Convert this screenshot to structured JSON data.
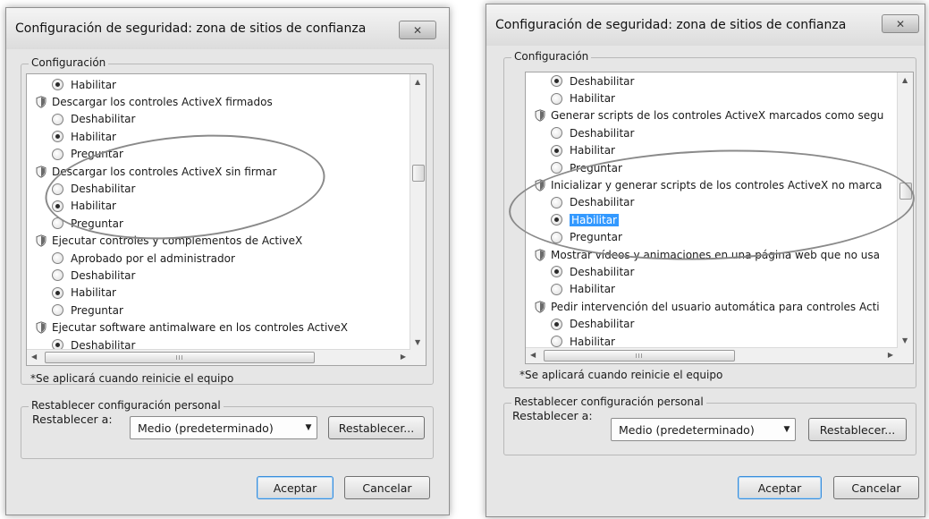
{
  "dialogs": [
    {
      "title": "Configuración de seguridad: zona de sitios de confianza",
      "close_symbol": "✕",
      "group_label": "Configuración",
      "rows": [
        {
          "kind": "option",
          "text": "Habilitar",
          "checked": true
        },
        {
          "kind": "setting",
          "text": "Descargar los controles ActiveX firmados"
        },
        {
          "kind": "option",
          "text": "Deshabilitar",
          "checked": false
        },
        {
          "kind": "option",
          "text": "Habilitar",
          "checked": true
        },
        {
          "kind": "option",
          "text": "Preguntar",
          "checked": false
        },
        {
          "kind": "setting",
          "text": "Descargar los controles ActiveX sin firmar"
        },
        {
          "kind": "option",
          "text": "Deshabilitar",
          "checked": false
        },
        {
          "kind": "option",
          "text": "Habilitar",
          "checked": true
        },
        {
          "kind": "option",
          "text": "Preguntar",
          "checked": false
        },
        {
          "kind": "setting",
          "text": "Ejecutar controles y complementos de ActiveX"
        },
        {
          "kind": "option",
          "text": "Aprobado por el administrador",
          "checked": false
        },
        {
          "kind": "option",
          "text": "Deshabilitar",
          "checked": false
        },
        {
          "kind": "option",
          "text": "Habilitar",
          "checked": true
        },
        {
          "kind": "option",
          "text": "Preguntar",
          "checked": false
        },
        {
          "kind": "setting",
          "text": "Ejecutar software antimalware en los controles ActiveX"
        },
        {
          "kind": "option",
          "text": "Deshabilitar",
          "checked": true
        }
      ],
      "hscroll_grip": "III",
      "restart_note": "*Se aplicará cuando reinicie el equipo",
      "reset_group_label": "Restablecer configuración personal",
      "reset_to_label": "Restablecer a:",
      "reset_select_value": "Medio (predeterminado)",
      "reset_button": "Restablecer...",
      "ok_button": "Aceptar",
      "cancel_button": "Cancelar"
    },
    {
      "title": "Configuración de seguridad: zona de sitios de confianza",
      "close_symbol": "✕",
      "group_label": "Configuración",
      "rows": [
        {
          "kind": "option",
          "text": "Deshabilitar",
          "checked": true
        },
        {
          "kind": "option",
          "text": "Habilitar",
          "checked": false
        },
        {
          "kind": "setting",
          "text": "Generar scripts de los controles ActiveX marcados como segu"
        },
        {
          "kind": "option",
          "text": "Deshabilitar",
          "checked": false
        },
        {
          "kind": "option",
          "text": "Habilitar",
          "checked": true
        },
        {
          "kind": "option",
          "text": "Preguntar",
          "checked": false
        },
        {
          "kind": "setting",
          "text": "Inicializar y generar scripts de los controles ActiveX no marca"
        },
        {
          "kind": "option",
          "text": "Deshabilitar",
          "checked": false
        },
        {
          "kind": "option",
          "text": "Habilitar",
          "checked": true,
          "selected": true
        },
        {
          "kind": "option",
          "text": "Preguntar",
          "checked": false
        },
        {
          "kind": "setting",
          "text": "Mostrar vídeos y animaciones en una página web que no usa"
        },
        {
          "kind": "option",
          "text": "Deshabilitar",
          "checked": true
        },
        {
          "kind": "option",
          "text": "Habilitar",
          "checked": false
        },
        {
          "kind": "setting",
          "text": "Pedir intervención del usuario automática para controles Acti"
        },
        {
          "kind": "option",
          "text": "Deshabilitar",
          "checked": true
        },
        {
          "kind": "option",
          "text": "Habilitar",
          "checked": false
        }
      ],
      "hscroll_grip": "III",
      "restart_note": "*Se aplicará cuando reinicie el equipo",
      "reset_group_label": "Restablecer configuración personal",
      "reset_to_label": "Restablecer a:",
      "reset_select_value": "Medio (predeterminado)",
      "reset_button": "Restablecer...",
      "ok_button": "Aceptar",
      "cancel_button": "Cancelar"
    }
  ]
}
